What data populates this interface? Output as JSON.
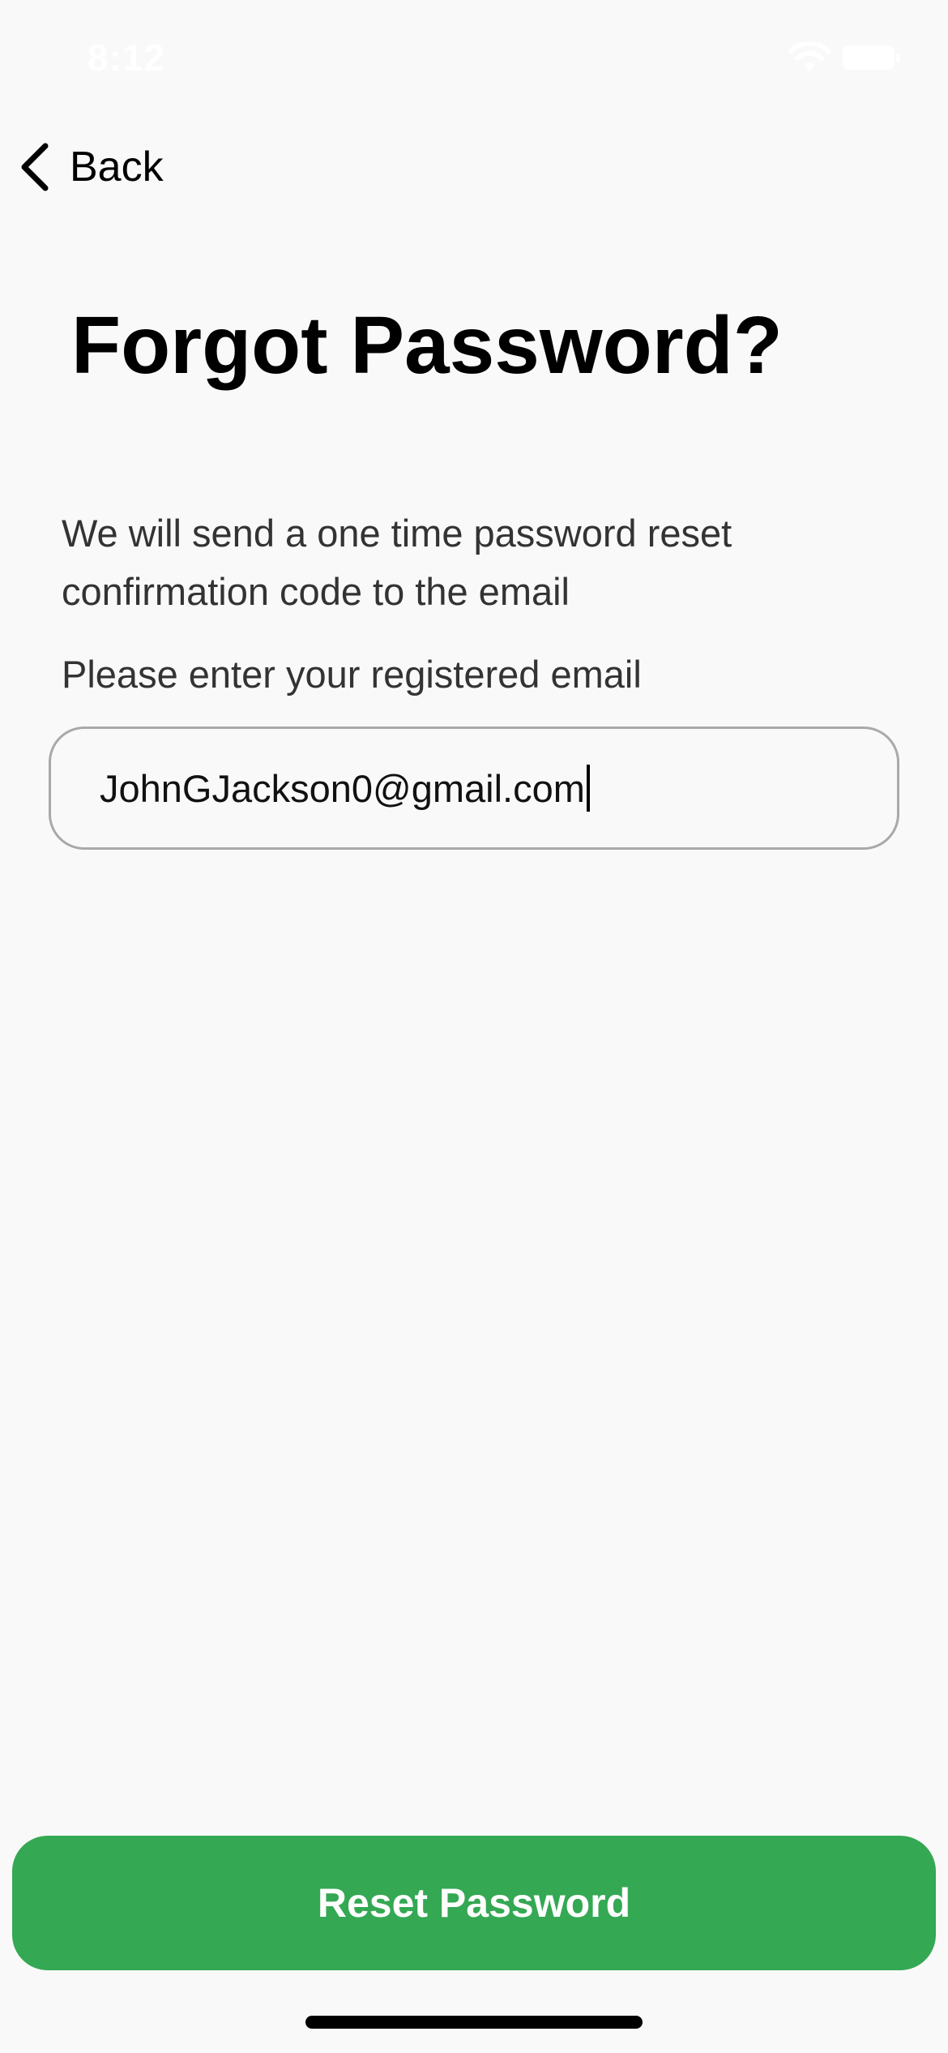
{
  "status_bar": {
    "time": "8:12",
    "wifi_icon": "wifi-icon",
    "battery_icon": "battery-icon"
  },
  "nav": {
    "back_icon": "chevron-left-icon",
    "back_label": "Back"
  },
  "title": "Forgot Password?",
  "description": "We will send a one time password reset confirmation code to the email",
  "prompt": "Please enter your registered email",
  "email_field": {
    "value": "JohnGJackson0@gmail.com"
  },
  "reset_button": {
    "label": "Reset Password"
  },
  "colors": {
    "background": "#f9f9f9",
    "accent": "#34a853",
    "input_border": "#a9a9a9",
    "body_text": "#333333"
  }
}
